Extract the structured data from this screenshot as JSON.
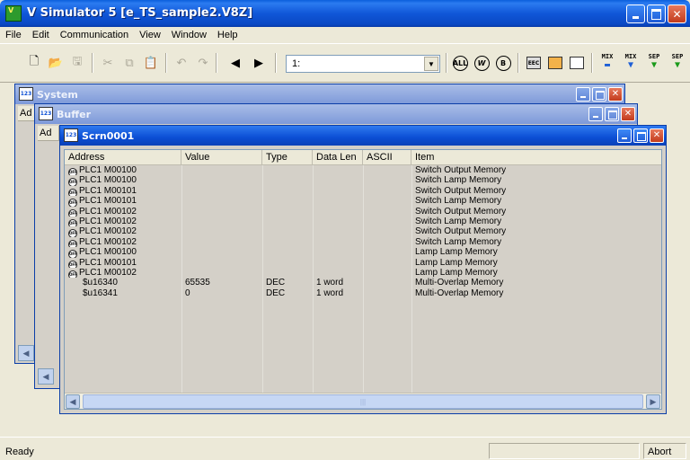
{
  "app": {
    "title": "V Simulator 5 [e_TS_sample2.V8Z]",
    "icon": "app-logo-icon"
  },
  "menu": [
    "File",
    "Edit",
    "Communication",
    "View",
    "Window",
    "Help"
  ],
  "toolbar": {
    "combo_value": "1:",
    "labels": {
      "mix1": "MIX",
      "mix2": "MIX",
      "sep1": "SEP",
      "sep2": "SEP"
    },
    "circle_buttons": [
      "ALL",
      "W",
      "B"
    ],
    "monitor_labels": [
      "EEC",
      "",
      ""
    ]
  },
  "windows": {
    "system": {
      "title": "System",
      "col_stub": "Ad"
    },
    "buffer": {
      "title": "Buffer",
      "col_stub": "Ad"
    },
    "scrn": {
      "title": "Scrn0001",
      "columns": [
        "Address",
        "Value",
        "Type",
        "Data Len",
        "ASCII",
        "Item"
      ],
      "rows": [
        {
          "icon": true,
          "address": "PLC1 M00100",
          "value": "",
          "type": "",
          "len": "",
          "ascii": "",
          "item": "Switch Output Memory"
        },
        {
          "icon": true,
          "address": "PLC1 M00100",
          "value": "",
          "type": "",
          "len": "",
          "ascii": "",
          "item": "Switch Lamp Memory"
        },
        {
          "icon": true,
          "address": "PLC1 M00101",
          "value": "",
          "type": "",
          "len": "",
          "ascii": "",
          "item": "Switch Output Memory"
        },
        {
          "icon": true,
          "address": "PLC1 M00101",
          "value": "",
          "type": "",
          "len": "",
          "ascii": "",
          "item": "Switch Lamp Memory"
        },
        {
          "icon": true,
          "address": "PLC1 M00102",
          "value": "",
          "type": "",
          "len": "",
          "ascii": "",
          "item": "Switch Output Memory"
        },
        {
          "icon": true,
          "address": "PLC1 M00102",
          "value": "",
          "type": "",
          "len": "",
          "ascii": "",
          "item": "Switch Lamp Memory"
        },
        {
          "icon": true,
          "address": "PLC1 M00102",
          "value": "",
          "type": "",
          "len": "",
          "ascii": "",
          "item": "Switch Output Memory"
        },
        {
          "icon": true,
          "address": "PLC1 M00102",
          "value": "",
          "type": "",
          "len": "",
          "ascii": "",
          "item": "Switch Lamp Memory"
        },
        {
          "icon": true,
          "address": "PLC1 M00100",
          "value": "",
          "type": "",
          "len": "",
          "ascii": "",
          "item": "Lamp Lamp Memory"
        },
        {
          "icon": true,
          "address": "PLC1 M00101",
          "value": "",
          "type": "",
          "len": "",
          "ascii": "",
          "item": "Lamp Lamp Memory"
        },
        {
          "icon": true,
          "address": "PLC1 M00102",
          "value": "",
          "type": "",
          "len": "",
          "ascii": "",
          "item": "Lamp Lamp Memory"
        },
        {
          "icon": false,
          "address": "$u16340",
          "value": "65535",
          "type": "DEC",
          "len": "1 word",
          "ascii": "",
          "item": "Multi-Overlap Memory"
        },
        {
          "icon": false,
          "address": "$u16341",
          "value": "0",
          "type": "DEC",
          "len": "1 word",
          "ascii": "",
          "item": "Multi-Overlap Memory"
        }
      ]
    }
  },
  "status": {
    "text": "Ready",
    "abort": "Abort"
  },
  "colors": {
    "title_active": "#0b4ed4",
    "title_inactive": "#7d99d9",
    "face": "#ece9d8",
    "list_bg": "#d4d0c8"
  }
}
